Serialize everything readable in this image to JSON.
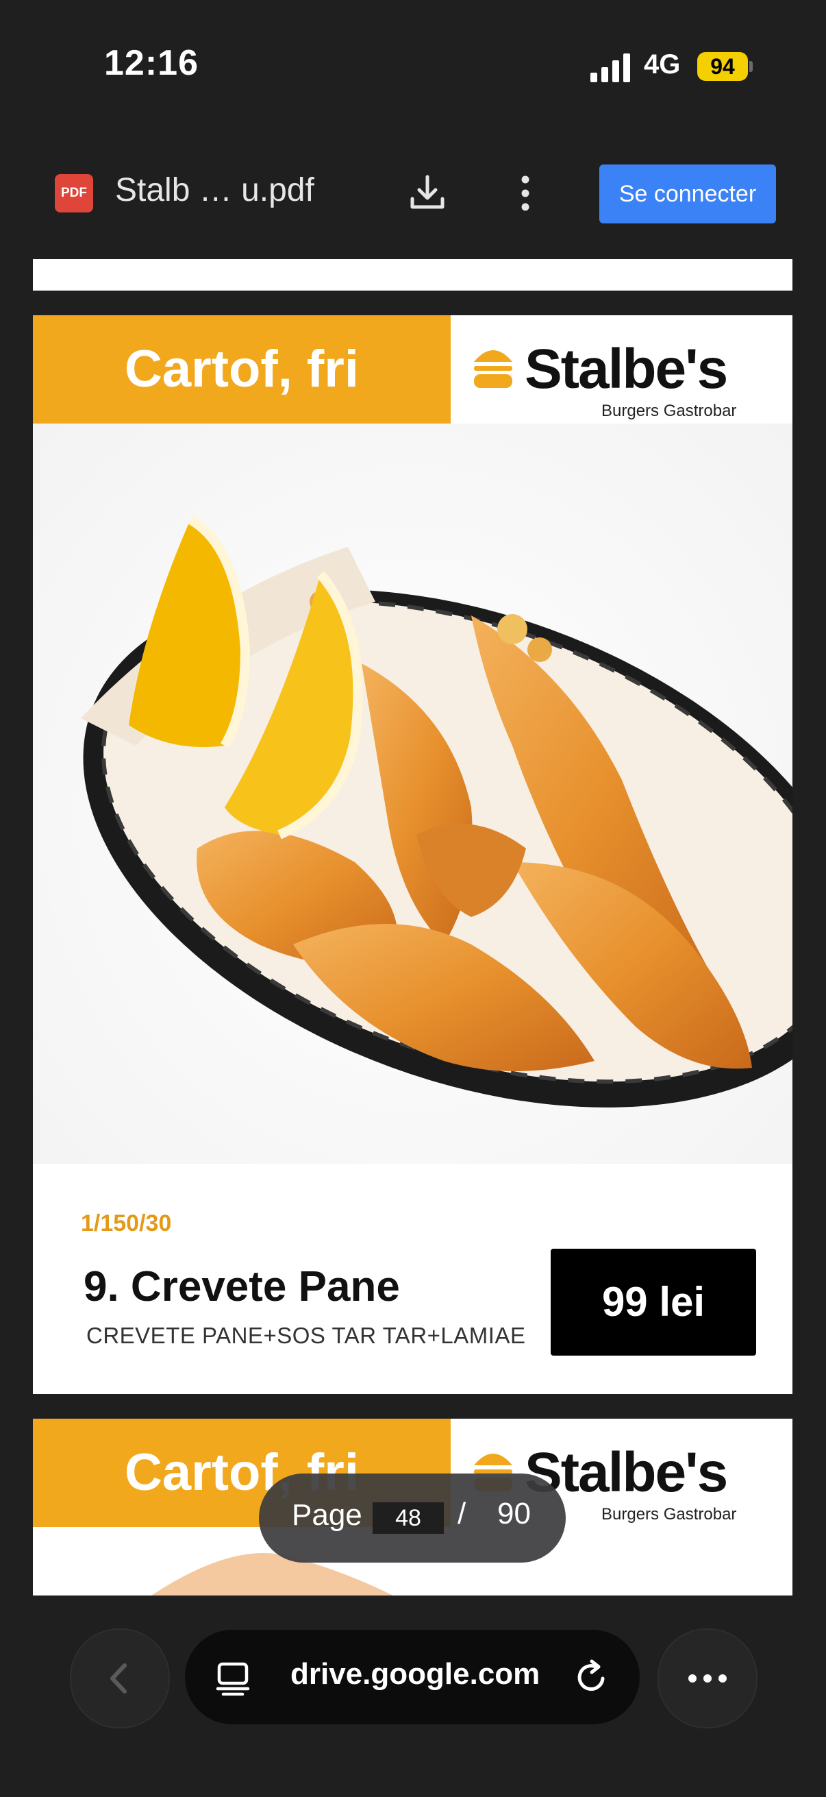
{
  "status_bar": {
    "time": "12:16",
    "network": "4G",
    "battery": "94"
  },
  "app_bar": {
    "pdf_badge": "PDF",
    "file_name": "Stalb … u.pdf",
    "download_icon": "download-icon",
    "more_icon": "more-vert-icon",
    "connect_label": "Se connecter"
  },
  "pdf_page": {
    "category": "Cartof, fri",
    "brand_name": "Stalbe's",
    "brand_sub": "Burgers Gastrobar",
    "portion": "1/150/30",
    "dish_name": "9. Crevete Pane",
    "dish_desc": "CREVETE PANE+SOS TAR TAR+LAMIAE",
    "price": "99 lei"
  },
  "next_page": {
    "category": "Cartof, fri",
    "brand_name": "Stalbe's",
    "brand_sub": "Burgers Gastrobar"
  },
  "page_indicator": {
    "label": "Page",
    "current": "48",
    "separator": "/",
    "total": "90"
  },
  "browser_bar": {
    "back_icon": "chevron-left-icon",
    "url": "drive.google.com",
    "reload_icon": "reload-icon",
    "menu_icon": "more-horiz-icon"
  },
  "colors": {
    "accent": "#f2a81d",
    "button": "#3b82f6",
    "battery": "#f5d000",
    "pdf_red": "#e0453a"
  }
}
